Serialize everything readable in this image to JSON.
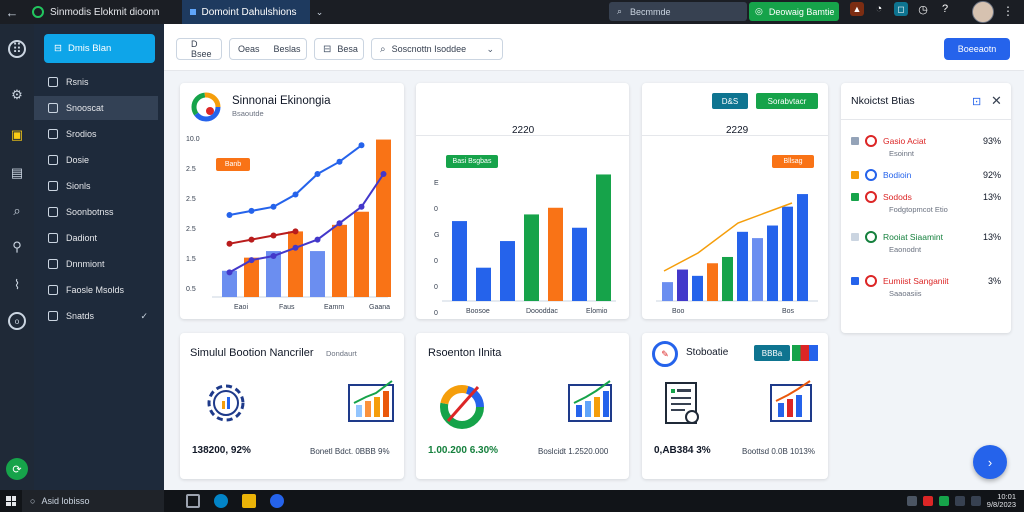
{
  "window": {
    "app_title": "Sinmodis Elokmit dioonn",
    "active_tab": "Domoint Dahulshions"
  },
  "topbar": {
    "search_label": "Becmmde",
    "action_label": "Deowaig Bamtie"
  },
  "sidebar": {
    "primary_button": "Dmis Blan",
    "items": [
      {
        "label": "Rsnis"
      },
      {
        "label": "Snooscat"
      },
      {
        "label": "Srodios"
      },
      {
        "label": "Dosie"
      },
      {
        "label": "Sionls"
      },
      {
        "label": "Soonbotnss"
      },
      {
        "label": "Dadiont"
      },
      {
        "label": "Dnnmiont"
      },
      {
        "label": "Faosle Msolds"
      },
      {
        "label": "Snatds"
      }
    ]
  },
  "toolbar": {
    "btn1": "D Bsee",
    "btn2": "Oeas",
    "btn3": "Beslas",
    "btn4": "Besa",
    "select_value": "Soscnottn Isoddee",
    "primary": "Boeeaotn"
  },
  "cards": {
    "c1": {
      "title": "Sinnonai Ekinongia",
      "subtitle": "Bsaoutde",
      "badge": "Banb"
    },
    "c2": {
      "header_value": "2220",
      "badge": "Basi Bsgbas"
    },
    "c3": {
      "header_value": "2229",
      "badge": "Bllsag",
      "pill_left": "D&S",
      "pill_right": "Sorabvtacr"
    },
    "right": {
      "title": "Nkoictst Btias"
    },
    "c4": {
      "title": "Simulul Bootion Nancriler",
      "subtitle": "Dondaurt",
      "kpi": "138200, 92%",
      "note": "Bonetl Bdct. 0BBB 9%"
    },
    "c5": {
      "title": "Rsoenton Ilnita",
      "kpi": "1.00.200 6.30%",
      "note": "Boslcidt 1.2520.000"
    },
    "c6": {
      "title": "Stoboatie",
      "pill": "BBBa",
      "kpi": "0,AB384 3%",
      "note": "Boottsd 0.0B 1013%"
    }
  },
  "right_panel": {
    "rows": [
      {
        "label": "Gasio Aciat",
        "sub": "Esoinnt",
        "pct": "93%",
        "color": "#dc2626"
      },
      {
        "label": "Bodioin",
        "sub": "",
        "pct": "92%",
        "color": "#2563eb"
      },
      {
        "label": "Sodods",
        "sub": "Fodgtopmcot Etio",
        "pct": "13%",
        "color": "#dc2626"
      },
      {
        "label": "Rooiat Siaamint",
        "sub": "Eaonodnt",
        "pct": "13%",
        "color": "#15803d"
      },
      {
        "label": "Eumiist Sanganiit",
        "sub": "Saaoasiis",
        "pct": "3%",
        "color": "#dc2626"
      }
    ]
  },
  "taskbar": {
    "search_label": "Asid lobisso",
    "time": "10:01",
    "date": "9/8/2023"
  },
  "chart_data": [
    {
      "type": "bar",
      "categories": [
        "Eaoi",
        "Faus",
        "Eamm",
        "Gaana"
      ],
      "series": [
        {
          "values": [
            4,
            6,
            7,
            10,
            7,
            11,
            13,
            24
          ]
        }
      ],
      "lines": [
        {
          "color": "#2563eb",
          "values": [
            20,
            21,
            22,
            25,
            30,
            33,
            37
          ]
        },
        {
          "color": "#4338ca",
          "values": [
            6,
            9,
            10,
            12,
            14,
            18,
            22,
            30
          ]
        },
        {
          "color": "#b91c1c",
          "values": [
            13,
            14,
            15,
            16
          ]
        }
      ],
      "ytick_labels": [
        "10.0",
        "2.5",
        "2.5",
        "2.5",
        "1.5",
        "0.5"
      ]
    },
    {
      "type": "bar",
      "categories": [
        "Boosoe",
        "Doooddac",
        "Elomio"
      ],
      "ytick_labels": [
        "E",
        "0",
        "G",
        "0",
        "0",
        "0"
      ],
      "series": [
        {
          "values": [
            60,
            25,
            45,
            65,
            70,
            45,
            55,
            75,
            95
          ]
        }
      ]
    },
    {
      "type": "bar",
      "categories": [
        "Boo",
        "Bos"
      ],
      "series": [
        {
          "values": [
            15,
            25,
            20,
            30,
            35,
            55,
            50,
            60,
            75,
            85
          ]
        }
      ]
    }
  ]
}
